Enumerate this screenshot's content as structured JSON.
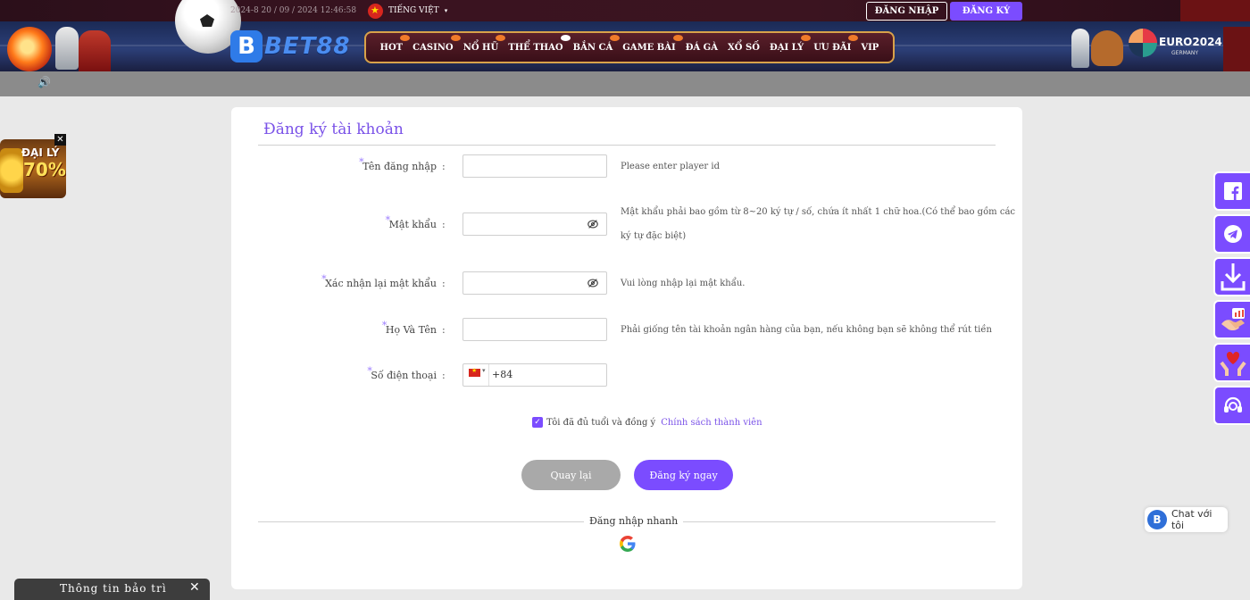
{
  "header": {
    "datetime": "2024-8 20 / 09 / 2024 12:46:58",
    "language": "TIẾNG VIỆT",
    "login_label": "ĐĂNG NHẬP",
    "register_label": "ĐĂNG KÝ",
    "brand": "BET88",
    "brand_mark": "B",
    "nav": [
      "HOT",
      "CASINO",
      "NỔ HŨ",
      "THỂ THAO",
      "BẮN CÁ",
      "GAME BÀI",
      "ĐÁ GÀ",
      "XỔ SỐ",
      "ĐẠI LÝ",
      "ƯU ĐÃI",
      "VIP"
    ],
    "euro_text": "EURO2024",
    "euro_sub": "GERMANY"
  },
  "promo": {
    "line1": "ĐẠI LÝ",
    "line2": "70%"
  },
  "form": {
    "title": "Đăng ký tài khoản",
    "colon": ":",
    "username": {
      "label": "Tên đăng nhập",
      "hint": "Please enter player id"
    },
    "password": {
      "label": "Mật khẩu",
      "hint": "Mật khẩu phải bao gồm từ 8~20 ký tự / số, chứa ít nhất 1 chữ hoa.(Có thể bao gồm các",
      "hint2": "ký tự đặc biệt)"
    },
    "confirm": {
      "label": "Xác nhận lại mật khẩu",
      "hint": "Vui lòng nhập lại mật khẩu."
    },
    "fullname": {
      "label": "Họ Và Tên",
      "hint": "Phải giống tên tài khoản ngân hàng của bạn, nếu không bạn sẽ không thể rút tiền"
    },
    "phone": {
      "label": "Số điện thoại",
      "code": "+84"
    },
    "agree_text": "Tôi đã đủ tuổi và đồng ý",
    "agree_link": "Chính sách thành viên",
    "back_label": "Quay lại",
    "submit_label": "Đăng ký ngay",
    "quick_login": "Đăng nhập nhanh"
  },
  "side": {
    "buttons": [
      "facebook-icon",
      "telegram-icon",
      "download-icon",
      "agent-icon",
      "charity-icon",
      "support-icon"
    ],
    "chat_label": "Chat với tôi"
  },
  "maintenance": {
    "label": "Thông tin bảo trì"
  },
  "colors": {
    "accent": "#7b4cff",
    "title": "#7a52e8",
    "back": "#a9a9a9"
  }
}
